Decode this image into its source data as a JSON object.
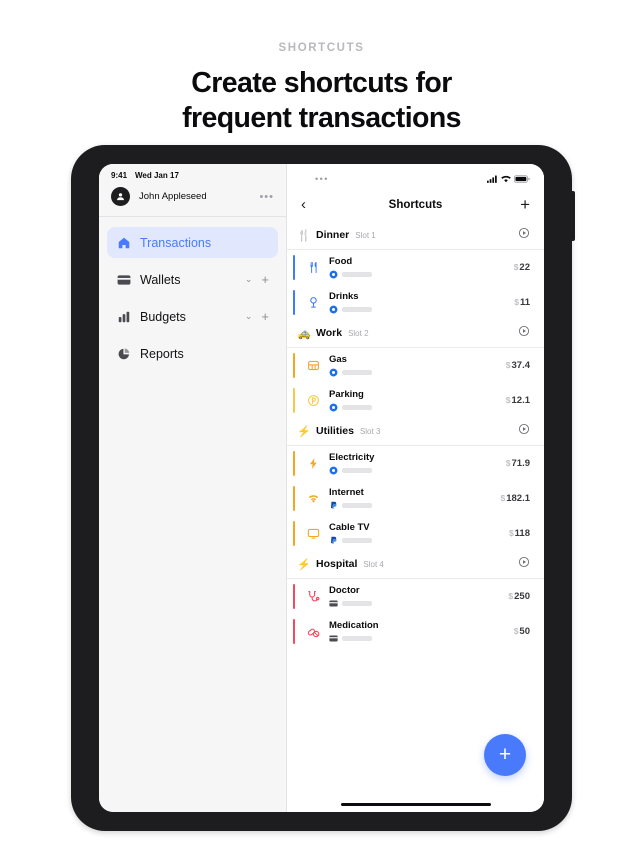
{
  "promo": {
    "eyebrow": "SHORTCUTS",
    "title_line1": "Create shortcuts for",
    "title_line2": "frequent transactions"
  },
  "device": {
    "status_bar": {
      "time": "9:41",
      "date": "Wed Jan 17",
      "signal_icon": "cellular-bars-icon",
      "wifi_icon": "wifi-icon",
      "battery_icon": "battery-icon",
      "grabber": "•••"
    },
    "sidebar": {
      "account": {
        "name": "John Appleseed",
        "avatar_icon": "person-circle-avatar",
        "more_label": "•••"
      },
      "items": [
        {
          "label": "Transactions",
          "icon": "home-icon",
          "active": true,
          "has_chevron": false,
          "has_plus": false
        },
        {
          "label": "Wallets",
          "icon": "card-icon",
          "active": false,
          "has_chevron": true,
          "has_plus": true
        },
        {
          "label": "Budgets",
          "icon": "bar-chart-icon",
          "active": false,
          "has_chevron": true,
          "has_plus": true
        },
        {
          "label": "Reports",
          "icon": "pie-chart-icon",
          "active": false,
          "has_chevron": false,
          "has_plus": false
        }
      ],
      "chevron_glyph": "⌄",
      "plus_glyph": "+"
    },
    "navbar": {
      "back_glyph": "‹",
      "title": "Shortcuts",
      "add_glyph": "+"
    },
    "slots": [
      {
        "emoji": "🍴",
        "name": "Dinner",
        "slot_label": "Slot 1",
        "run_icon": "play-circle-icon",
        "rows": [
          {
            "title": "Food",
            "icon": "cutlery-icon",
            "bar_color": "#3f7bfb",
            "icon_color": "#3f7bfb",
            "payment_icon": "blue-circle-card-icon",
            "currency": "$",
            "amount": "22"
          },
          {
            "title": "Drinks",
            "icon": "wine-glass-icon",
            "bar_color": "#3f7bfb",
            "icon_color": "#3f7bfb",
            "payment_icon": "blue-circle-card-icon",
            "currency": "$",
            "amount": "11"
          }
        ]
      },
      {
        "emoji": "🚕",
        "name": "Work",
        "slot_label": "Slot 2",
        "run_icon": "play-circle-icon",
        "rows": [
          {
            "title": "Gas",
            "icon": "fuel-grid-icon",
            "bar_color": "#f5a623",
            "icon_color": "#f5a623",
            "payment_icon": "blue-circle-card-icon",
            "currency": "$",
            "amount": "37.4"
          },
          {
            "title": "Parking",
            "icon": "parking-icon",
            "bar_color": "#f7c948",
            "icon_color": "#f7c948",
            "payment_icon": "blue-circle-card-icon",
            "currency": "$",
            "amount": "12.1"
          }
        ]
      },
      {
        "emoji": "⚡",
        "name": "Utilities",
        "slot_label": "Slot 3",
        "run_icon": "play-circle-icon",
        "rows": [
          {
            "title": "Electricity",
            "icon": "bolt-icon",
            "bar_color": "#f5a623",
            "icon_color": "#f5a623",
            "payment_icon": "blue-circle-card-icon",
            "currency": "$",
            "amount": "71.9"
          },
          {
            "title": "Internet",
            "icon": "wifi-icon",
            "bar_color": "#f5a623",
            "icon_color": "#f5a623",
            "payment_icon": "paypal-icon",
            "currency": "$",
            "amount": "182.1"
          },
          {
            "title": "Cable TV",
            "icon": "monitor-icon",
            "bar_color": "#f5a623",
            "icon_color": "#f5a623",
            "payment_icon": "paypal-icon",
            "currency": "$",
            "amount": "118"
          }
        ]
      },
      {
        "emoji": "⚡",
        "name": "Hospital",
        "slot_label": "Slot 4",
        "run_icon": "play-circle-icon",
        "rows": [
          {
            "title": "Doctor",
            "icon": "stethoscope-icon",
            "bar_color": "#f2495c",
            "icon_color": "#f2495c",
            "payment_icon": "credit-card-icon",
            "currency": "$",
            "amount": "250"
          },
          {
            "title": "Medication",
            "icon": "pills-icon",
            "bar_color": "#f2495c",
            "icon_color": "#f2495c",
            "payment_icon": "credit-card-icon",
            "currency": "$",
            "amount": "50"
          }
        ]
      }
    ],
    "fab": {
      "glyph": "+",
      "color": "#4a7afc"
    }
  }
}
